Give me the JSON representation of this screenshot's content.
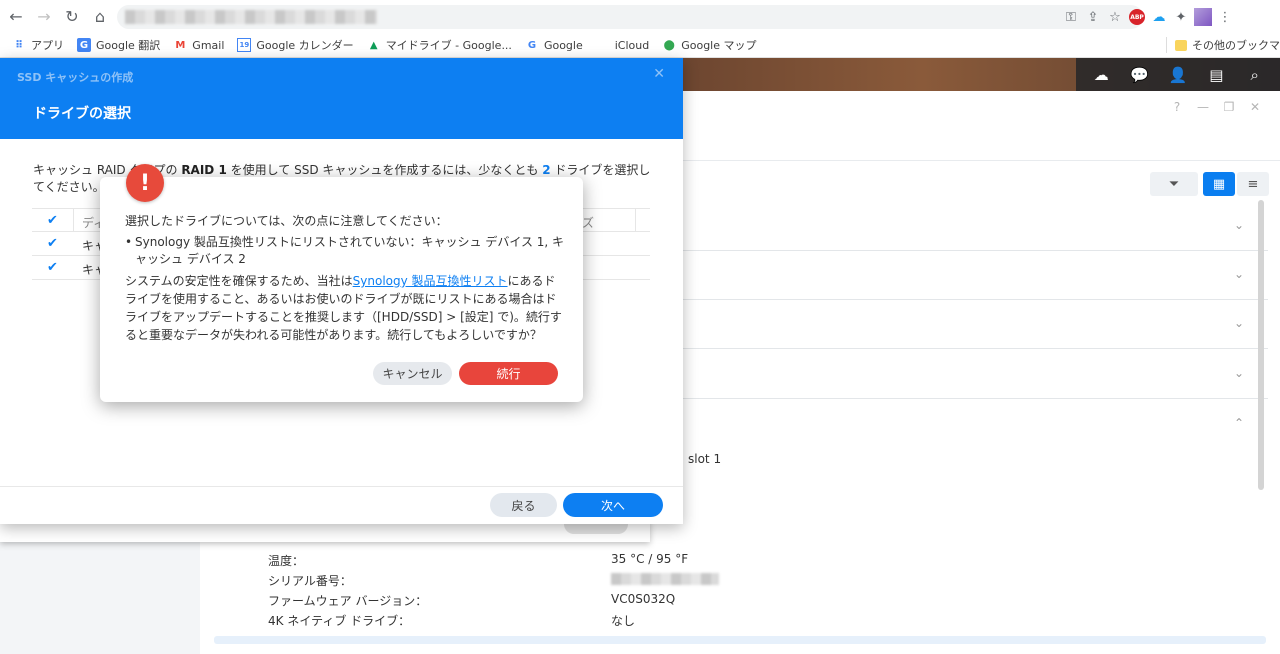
{
  "browser": {
    "bookmarks": [
      {
        "label": "アプリ",
        "icon": "apps-grid-icon"
      },
      {
        "label": "Google 翻訳",
        "icon": "google-translate-icon"
      },
      {
        "label": "Gmail",
        "icon": "gmail-icon"
      },
      {
        "label": "Google カレンダー",
        "icon": "google-calendar-icon"
      },
      {
        "label": "マイドライブ - Google...",
        "icon": "google-drive-icon"
      },
      {
        "label": "Google",
        "icon": "google-icon"
      },
      {
        "label": "iCloud",
        "icon": "apple-icon"
      },
      {
        "label": "Google マップ",
        "icon": "google-maps-icon"
      }
    ],
    "other_bookmarks": "その他のブックマーク",
    "calendar_badge": "19",
    "abp_badge": "ABP"
  },
  "wizard": {
    "window_title": "SSD キャッシュの作成",
    "step_title": "ドライブの選択",
    "description_prefix": "キャッシュ RAID タイプの",
    "description_raid": "RAID 1",
    "description_mid": "を使用して SSD キャッシュを作成するには、少なくとも",
    "description_count": "2",
    "description_suffix": "ドライブを選択してください。",
    "table": {
      "header_name": "ディ",
      "header_size": "ズ",
      "rows": [
        {
          "name": "キャ"
        },
        {
          "name": "キャ"
        }
      ]
    },
    "back_label": "戻る",
    "next_label": "次へ"
  },
  "alert": {
    "icon_glyph": "!",
    "intro": "選択したドライブについては、次の点に注意してください：",
    "bullet": "Synology 製品互換性リストにリストされていない：キャッシュ デバイス 1, キャッシュ デバイス 2",
    "body_prefix": "システムの安定性を確保するため、当社は",
    "body_link": "Synology 製品互換性リスト",
    "body_suffix": "にあるドライブを使用すること、あるいはお使いのドライブが既にリストにある場合はドライブをアップデートすることを推奨します（[HDD/SSD] > [設定] で)。続行すると重要なデータが失われる可能性があります。続行してもよろしいですか？",
    "cancel_label": "キャンセル",
    "continue_label": "続行"
  },
  "storage_manager": {
    "slot_text": "slot 1",
    "details": [
      {
        "label": "温度：",
        "value": "35 °C / 95 °F"
      },
      {
        "label": "シリアル番号：",
        "value": ""
      },
      {
        "label": "ファームウェア バージョン：",
        "value": "VC0S032Q"
      },
      {
        "label": "4K ネイティブ ドライブ：",
        "value": "なし"
      }
    ]
  },
  "colors": {
    "dsm_blue": "#0d7ff2",
    "alert_red": "#e8453c"
  }
}
